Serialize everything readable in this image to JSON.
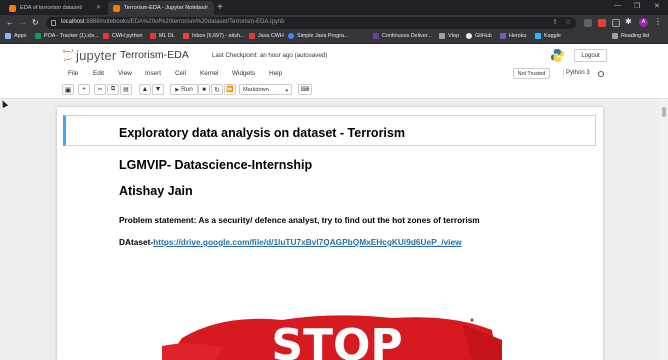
{
  "browser": {
    "tabs": [
      {
        "title": "EDA of terrorism dataset/",
        "active": false
      },
      {
        "title": "Terrorism-EDA - Jupyter Noteboo",
        "active": true
      }
    ],
    "url_host": "localhost",
    "url_path": ":8888/notebooks/EDA%20of%20terrorism%20dataset/Terrorism-EDA.ipynb",
    "bookmarks": [
      {
        "label": "Apps",
        "color": "#8ab4f8"
      },
      {
        "label": "POA - Tracker (1).xls...",
        "color": "#0f9d58"
      },
      {
        "label": "CWH python",
        "color": "#e53935"
      },
      {
        "label": "ML DL",
        "color": "#e53935"
      },
      {
        "label": "Inbox (5,697) - atish...",
        "color": "#ea4335"
      },
      {
        "label": "Java CWH",
        "color": "#e53935"
      },
      {
        "label": "Simple Java Progra...",
        "color": "#4285f4"
      },
      {
        "label": "Continuous Deliver...",
        "color": "#6b3fa0"
      },
      {
        "label": "Vtop",
        "color": "#9aa0a6"
      },
      {
        "label": "GitHub",
        "color": "#e8eaed"
      },
      {
        "label": "Heroku",
        "color": "#7e57c2"
      },
      {
        "label": "Kaggle",
        "color": "#20beff"
      }
    ],
    "reading_list": "Reading list",
    "profile_initial": "A"
  },
  "jupyter": {
    "logo_text": "jupyter",
    "notebook_name": "Terrorism-EDA",
    "checkpoint_label": "Last Checkpoint:",
    "checkpoint_time": "an hour ago",
    "autosave": "(autosaved)",
    "logout_label": "Logout",
    "menu": [
      "File",
      "Edit",
      "View",
      "Insert",
      "Cell",
      "Kernel",
      "Widgets",
      "Help"
    ],
    "trust_label": "Not Trusted",
    "kernel_name": "Python 3",
    "run_label": "Run",
    "cell_type": "Markdown"
  },
  "notebook": {
    "title": "Exploratory data analysis on dataset - Terrorism",
    "subtitle": "LGMVIP- Datascience-Internship",
    "author": "Atishay Jain",
    "problem": "Problem statement: As a security/ defence analyst, try to find out the hot zones of terrorism",
    "dataset_label": "DAtaset-",
    "dataset_link": "https://drive.google.com/file/d/1luTU7xBvl7QAGPbQMxEHcgKUi9d6UeP_/view",
    "image_text": "STOP"
  },
  "colors": {
    "accent": "#42a5f5",
    "link": "#296eaa",
    "stop_red": "#d71920"
  }
}
